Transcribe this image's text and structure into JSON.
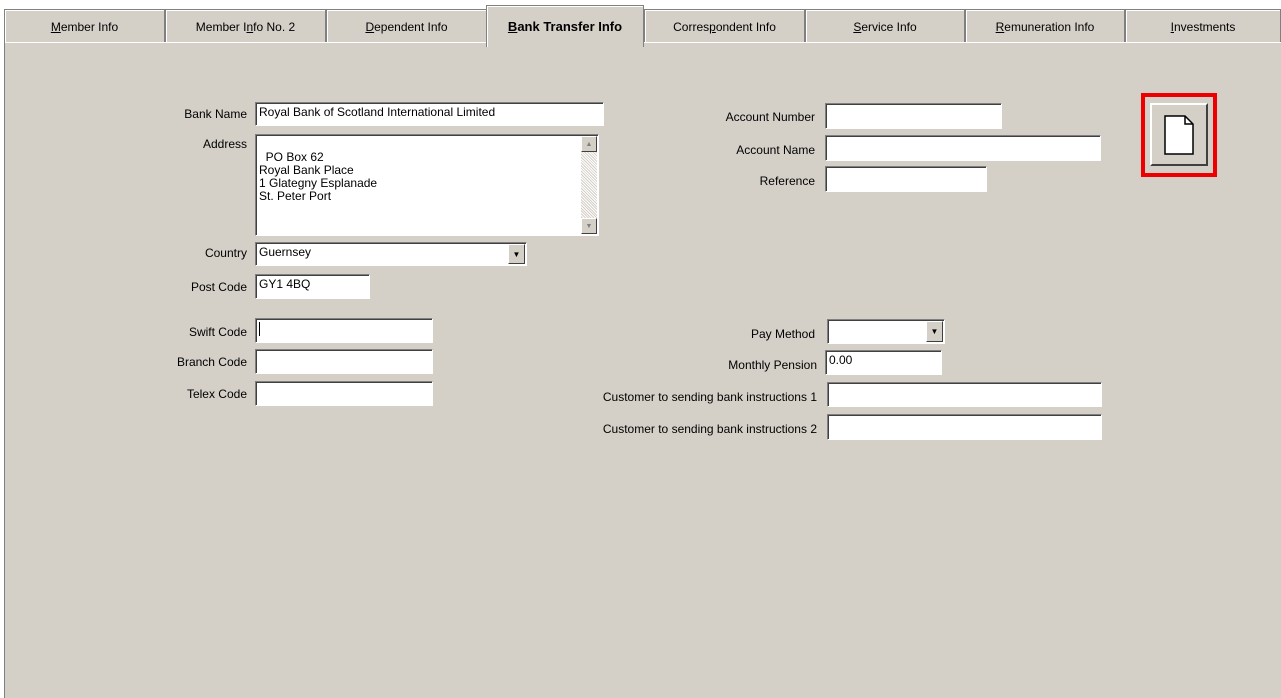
{
  "tabs": [
    {
      "pre": "",
      "u": "M",
      "post": "ember Info"
    },
    {
      "pre": "Member I",
      "u": "n",
      "post": "fo No. 2"
    },
    {
      "pre": "",
      "u": "D",
      "post": "ependent Info"
    },
    {
      "pre": "",
      "u": "B",
      "post": "ank Transfer Info"
    },
    {
      "pre": "Corres",
      "u": "p",
      "post": "ondent Info"
    },
    {
      "pre": "",
      "u": "S",
      "post": "ervice Info"
    },
    {
      "pre": "",
      "u": "R",
      "post": "emuneration Info"
    },
    {
      "pre": "",
      "u": "I",
      "post": "nvestments"
    }
  ],
  "active_tab": "Bank Transfer Info",
  "form": {
    "bank_name_label": "Bank Name",
    "bank_name_value": "Royal Bank of Scotland International Limited",
    "address_label": "Address",
    "address_value": "PO Box 62\nRoyal Bank Place\n1 Glategny Esplanade\nSt. Peter Port",
    "country_label": "Country",
    "country_value": "Guernsey",
    "post_code_label": "Post Code",
    "post_code_value": "GY1 4BQ",
    "swift_code_label": "Swift Code",
    "swift_code_value": "",
    "branch_code_label": "Branch Code",
    "branch_code_value": "",
    "telex_code_label": "Telex Code",
    "telex_code_value": "",
    "account_number_label": "Account Number",
    "account_number_value": "",
    "account_name_label": "Account Name",
    "account_name_value": "",
    "reference_label": "Reference",
    "reference_value": "",
    "pay_method_label": "Pay Method",
    "pay_method_value": "",
    "monthly_pension_label": "Monthly Pension",
    "monthly_pension_value": "0.00",
    "instr1_label": "Customer to sending bank instructions 1",
    "instr1_value": "",
    "instr2_label": "Customer to sending bank instructions 2",
    "instr2_value": ""
  },
  "icons": {
    "new_document": "new-document-icon",
    "highlight_color": "#ee0000"
  }
}
